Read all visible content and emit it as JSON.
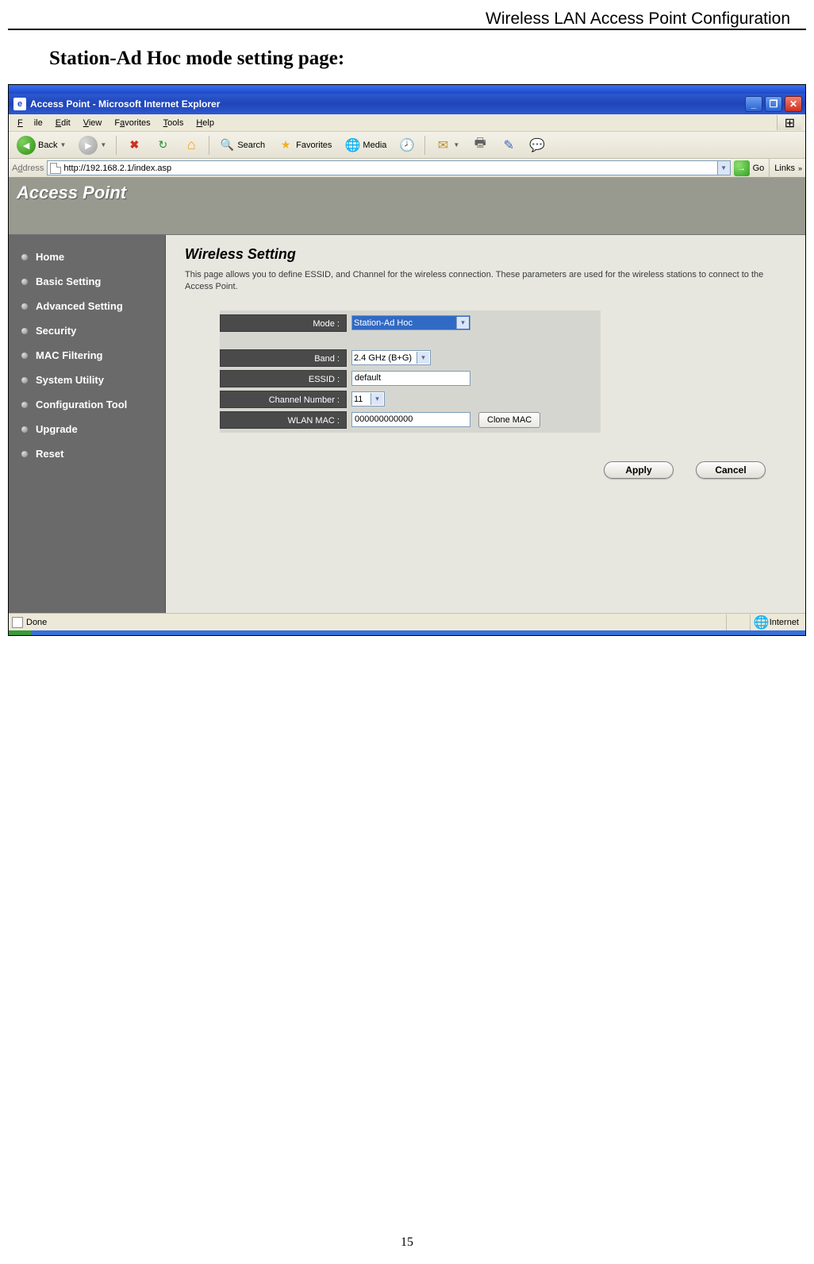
{
  "doc": {
    "header": "Wireless LAN Access Point Configuration",
    "section_title": "Station-Ad Hoc mode setting page:",
    "page_number": "15"
  },
  "browser": {
    "window_title": "Access Point - Microsoft Internet Explorer",
    "menu": {
      "file": "File",
      "edit": "Edit",
      "view": "View",
      "favorites": "Favorites",
      "tools": "Tools",
      "help": "Help"
    },
    "toolbar": {
      "back": "Back",
      "search": "Search",
      "favorites": "Favorites",
      "media": "Media"
    },
    "address_label": "Address",
    "address_value": "http://192.168.2.1/index.asp",
    "go_label": "Go",
    "links_label": "Links",
    "status_left": "Done",
    "status_zone": "Internet"
  },
  "page": {
    "banner": "Access Point",
    "nav": {
      "home": "Home",
      "basic": "Basic Setting",
      "advanced": "Advanced Setting",
      "security": "Security",
      "mac": "MAC Filtering",
      "system": "System Utility",
      "config": "Configuration Tool",
      "upgrade": "Upgrade",
      "reset": "Reset"
    },
    "content": {
      "heading": "Wireless Setting",
      "description": "This page allows you to define ESSID, and Channel for the wireless connection. These parameters are used for the wireless stations to connect to the Access Point.",
      "labels": {
        "mode": "Mode :",
        "band": "Band :",
        "essid": "ESSID :",
        "channel": "Channel Number :",
        "wlanmac": "WLAN MAC :"
      },
      "values": {
        "mode": "Station-Ad Hoc",
        "band": "2.4 GHz (B+G)",
        "essid": "default",
        "channel": "11",
        "wlanmac": "000000000000"
      },
      "buttons": {
        "clone": "Clone MAC",
        "apply": "Apply",
        "cancel": "Cancel"
      }
    }
  }
}
